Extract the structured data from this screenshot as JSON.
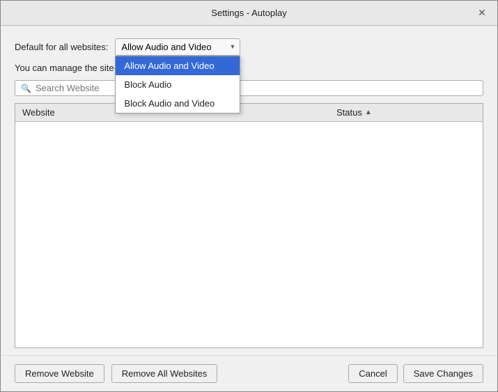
{
  "dialog": {
    "title": "Settings - Autoplay",
    "close_label": "✕"
  },
  "default_row": {
    "label": "Default for all websites:",
    "selected_value": "Allow Audio and Video"
  },
  "dropdown": {
    "options": [
      {
        "label": "Allow Audio and Video",
        "selected": true
      },
      {
        "label": "Block Audio",
        "selected": false
      },
      {
        "label": "Block Audio and Video",
        "selected": false
      }
    ]
  },
  "manage_text": "You can manage the site-specific Autoplay settings here.",
  "search": {
    "placeholder": "Search Website"
  },
  "table": {
    "col_website": "Website",
    "col_status": "Status",
    "rows": []
  },
  "footer": {
    "remove_website": "Remove Website",
    "remove_all": "Remove All Websites",
    "cancel": "Cancel",
    "save": "Save Changes"
  }
}
